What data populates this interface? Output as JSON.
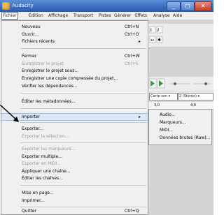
{
  "window": {
    "title": "Audacity",
    "min": "_",
    "max": "□",
    "close": "✕"
  },
  "menubar": {
    "items": [
      "Fichier",
      "Édition",
      "Affichage",
      "Transport",
      "Pistes",
      "Générer",
      "Effets",
      "Analyse",
      "Aide"
    ]
  },
  "file_menu": {
    "new": {
      "label": "Nouveau",
      "shortcut": "Ctrl+N"
    },
    "open": {
      "label": "Ouvrir...",
      "shortcut": "Ctrl+O"
    },
    "recent": {
      "label": "Fichiers récents",
      "arrow": "▸"
    },
    "close": {
      "label": "Fermer",
      "shortcut": "Ctrl+W"
    },
    "save_project": {
      "label": "Enregistrer le projet",
      "shortcut": "Ctrl+S"
    },
    "save_as": {
      "label": "Enregistrer le projet sous..."
    },
    "save_compressed": {
      "label": "Enregistrer une copie compressée du projet..."
    },
    "check_deps": {
      "label": "Vérifier les dépendances..."
    },
    "metadata": {
      "label": "Éditer les métadonnées..."
    },
    "import": {
      "label": "Importer",
      "arrow": "▸"
    },
    "export": {
      "label": "Exporter..."
    },
    "export_selection": {
      "label": "Exporter la sélection..."
    },
    "export_labels": {
      "label": "Exporter les marqueurs..."
    },
    "export_multiple": {
      "label": "Exporter multiple..."
    },
    "export_midi": {
      "label": "Exporter en MIDI..."
    },
    "apply_chain": {
      "label": "Appliquer une chaîne..."
    },
    "edit_chains": {
      "label": "Éditer les chaînes..."
    },
    "page_setup": {
      "label": "Mise en page..."
    },
    "print": {
      "label": "Imprimer..."
    },
    "quit": {
      "label": "Quitter",
      "shortcut": "Ctrl+Q"
    }
  },
  "import_submenu": [
    "Audio...",
    "Marqueurs...",
    "MIDI...",
    "Données brutes (Raw)..."
  ],
  "toolbar": {
    "combo1": "Carte son ▾",
    "combo2": "2 (Stéréo) ▾",
    "ruler_left": "3,0",
    "ruler_right": "4,0"
  }
}
